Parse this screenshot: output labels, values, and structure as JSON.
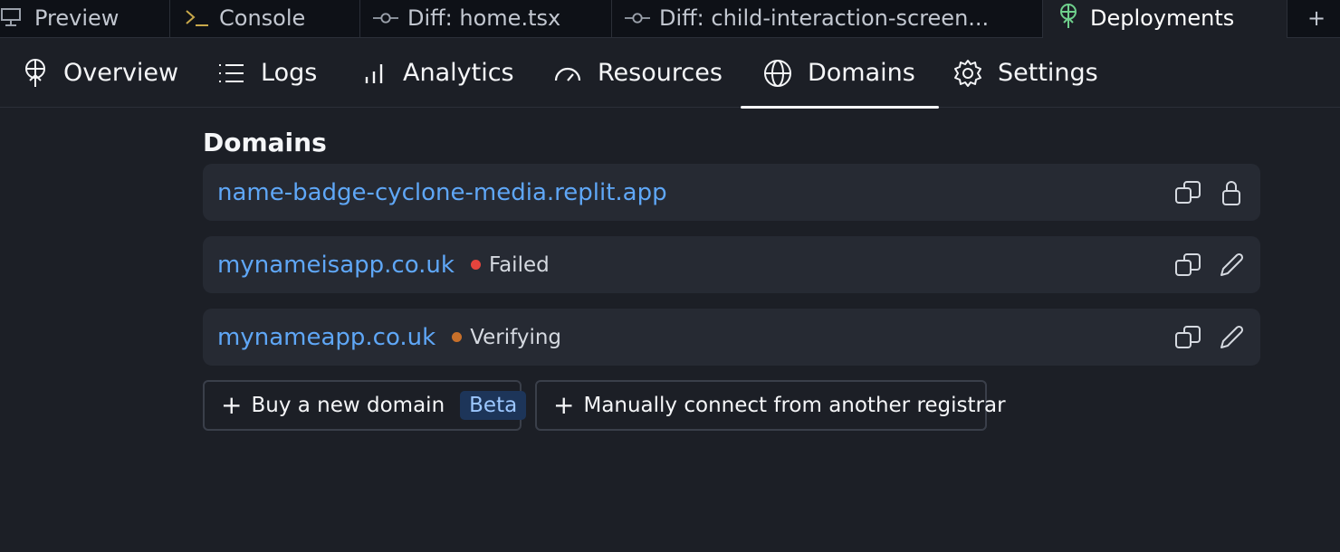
{
  "top_tabs": [
    {
      "label": "Preview",
      "icon": "monitor-icon"
    },
    {
      "label": "Console",
      "icon": "terminal-icon"
    },
    {
      "label": "Diff: home.tsx",
      "icon": "git-commit-icon"
    },
    {
      "label": "Diff: child-interaction-screen...",
      "icon": "git-commit-icon"
    },
    {
      "label": "Deployments",
      "icon": "deployments-icon",
      "active": true
    },
    {
      "label": "+",
      "icon": "plus-icon"
    }
  ],
  "subnav": [
    {
      "label": "Overview",
      "icon": "deployments-icon"
    },
    {
      "label": "Logs",
      "icon": "list-icon"
    },
    {
      "label": "Analytics",
      "icon": "bar-chart-icon"
    },
    {
      "label": "Resources",
      "icon": "gauge-icon"
    },
    {
      "label": "Domains",
      "icon": "globe-icon",
      "active": true
    },
    {
      "label": "Settings",
      "icon": "gear-icon"
    }
  ],
  "section_title": "Domains",
  "domains": [
    {
      "name": "name-badge-cyclone-media.replit.app",
      "status": "",
      "status_color": "",
      "actions": [
        "copy-icon",
        "lock-icon"
      ]
    },
    {
      "name": "mynameisapp.co.uk",
      "status": "Failed",
      "status_color": "#e5443d",
      "actions": [
        "copy-icon",
        "pencil-icon"
      ]
    },
    {
      "name": "mynameapp.co.uk",
      "status": "Verifying",
      "status_color": "#c8702a",
      "actions": [
        "copy-icon",
        "pencil-icon"
      ]
    }
  ],
  "buttons": {
    "buy_label": "Buy a new domain",
    "buy_badge": "Beta",
    "connect_label": "Manually connect from another registrar"
  },
  "colors": {
    "accent_link": "#5fa7f7",
    "background": "#1c1f26",
    "row_background": "#262a33",
    "deployments_icon": "#6fd08c"
  }
}
